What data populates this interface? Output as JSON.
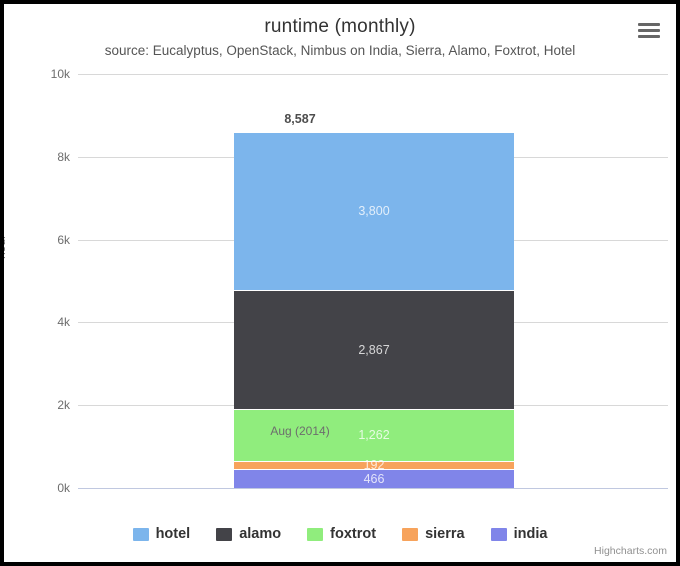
{
  "chart": {
    "title": "runtime (monthly)",
    "subtitle": "source: Eucalyptus, OpenStack, Nimbus on India, Sierra, Alamo, Foxtrot, Hotel",
    "credits": "Highcharts.com",
    "export_icon": "hamburger-menu-icon"
  },
  "chart_data": {
    "type": "bar",
    "stacked": true,
    "orientation": "vertical",
    "title": "runtime (monthly)",
    "subtitle": "source: Eucalyptus, OpenStack, Nimbus on India, Sierra, Alamo, Foxtrot, Hotel",
    "categories": [
      "Aug (2014)"
    ],
    "xlabel": "",
    "ylabel": "hour",
    "ylim": [
      0,
      10000
    ],
    "ytick_values": [
      0,
      2000,
      4000,
      6000,
      8000,
      10000
    ],
    "ytick_labels": [
      "0k",
      "2k",
      "4k",
      "6k",
      "8k",
      "10k"
    ],
    "grid": true,
    "legend_position": "bottom",
    "stack_total": 8587,
    "stack_total_label": "8,587",
    "series": [
      {
        "name": "hotel",
        "values": [
          3800
        ],
        "label": "3,800",
        "color": "#7cb5ec"
      },
      {
        "name": "alamo",
        "values": [
          2867
        ],
        "label": "2,867",
        "color": "#434348"
      },
      {
        "name": "foxtrot",
        "values": [
          1262
        ],
        "label": "1,262",
        "color": "#90ed7d"
      },
      {
        "name": "sierra",
        "values": [
          192
        ],
        "label": "192",
        "color": "#f7a35c"
      },
      {
        "name": "india",
        "values": [
          466
        ],
        "label": "466",
        "color": "#8085e9"
      }
    ],
    "stack_order_top_to_bottom": [
      "hotel",
      "alamo",
      "foxtrot",
      "sierra",
      "india"
    ]
  }
}
